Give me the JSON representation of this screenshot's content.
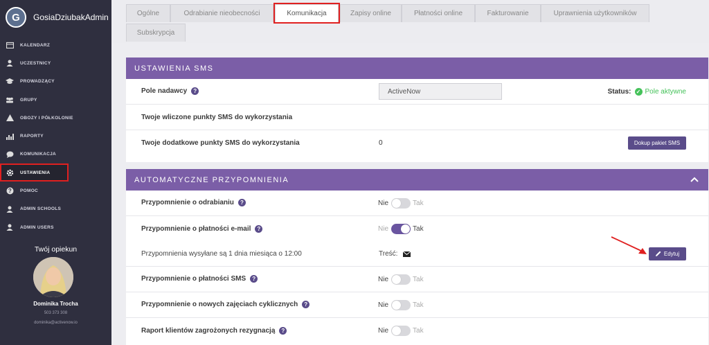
{
  "account": {
    "initial": "G",
    "name": "GosiaDziubakAdmin"
  },
  "nav": [
    {
      "label": "KALENDARZ",
      "icon": "calendar-icon"
    },
    {
      "label": "UCZESTNICY",
      "icon": "user-icon"
    },
    {
      "label": "PROWADZĄCY",
      "icon": "graduation-cap-icon"
    },
    {
      "label": "GRUPY",
      "icon": "group-icon"
    },
    {
      "label": "OBOZY I PÓŁKOLONIE",
      "icon": "tent-icon"
    },
    {
      "label": "RAPORTY",
      "icon": "bar-chart-icon"
    },
    {
      "label": "KOMUNIKACJA",
      "icon": "chat-icon"
    },
    {
      "label": "USTAWIENIA",
      "icon": "gear-icon"
    },
    {
      "label": "POMOC",
      "icon": "help-icon"
    },
    {
      "label": "ADMIN SCHOOLS",
      "icon": "user-icon"
    },
    {
      "label": "ADMIN USERS",
      "icon": "user-icon"
    }
  ],
  "opiekun": {
    "title": "Twój opiekun",
    "name": "Dominika Trocha",
    "phone": "503 373 308",
    "email": "dominika@activenow.io"
  },
  "tabs": [
    "Ogólne",
    "Odrabianie nieobecności",
    "Komunikacja",
    "Zapisy online",
    "Płatności online",
    "Fakturowanie",
    "Uprawnienia użytkowników",
    "Subskrypcja"
  ],
  "active_tab": "Komunikacja",
  "sms": {
    "header": "USTAWIENIA SMS",
    "sender_label": "Pole nadawcy",
    "sender_value": "ActiveNow",
    "status_label": "Status:",
    "status_value": "Pole aktywne",
    "points_label": "Twoje wliczone punkty SMS do wykorzystania",
    "extra_points_label": "Twoje dodatkowe punkty SMS do wykorzystania",
    "extra_points_value": "0",
    "buy_button": "Dokup pakiet SMS"
  },
  "reminders": {
    "header": "AUTOMATYCZNE PRZYPOMNIENIA",
    "off_label": "Nie",
    "on_label": "Tak",
    "rows": [
      {
        "label": "Przypomnienie o odrabianiu",
        "on": false
      },
      {
        "label": "Przypomnienie o płatności e-mail",
        "on": true
      },
      {
        "label": "Przypomnienie o płatności SMS",
        "on": false
      },
      {
        "label": "Przypomnienie o nowych zajęciach cyklicznych",
        "on": false
      },
      {
        "label": "Raport klientów zagrożonych rezygnacją",
        "on": false
      }
    ],
    "schedule_text": "Przypomnienia wysyłane są 1 dnia miesiąca o 12:00",
    "content_label": "Treść:",
    "edit_button": "Edytuj"
  },
  "colors": {
    "accent": "#7b5ea7",
    "sidebar": "#2f2f3f",
    "success": "#45c25a",
    "highlight": "#e02020"
  }
}
